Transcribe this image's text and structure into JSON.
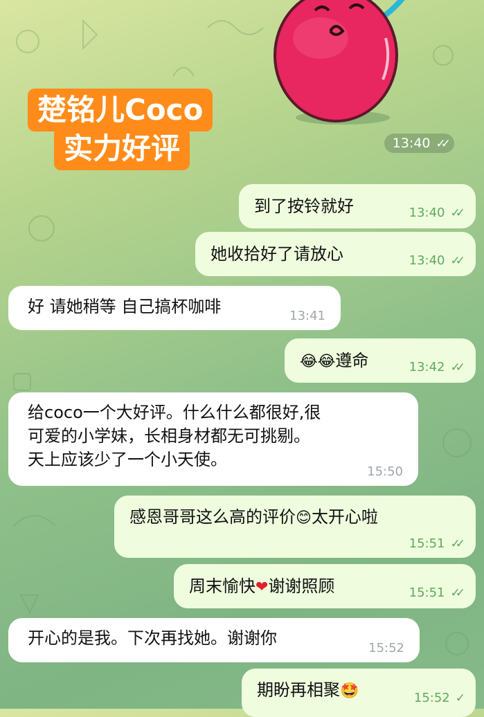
{
  "overlay": {
    "line1": "楚铭儿Coco",
    "line2": "实力好评"
  },
  "sticker": {
    "time": "13:40",
    "check": "✓✓"
  },
  "messages": [
    {
      "dir": "out",
      "text": "到了按铃就好",
      "time": "13:40",
      "check": "✓✓"
    },
    {
      "dir": "out",
      "text": "她收拾好了请放心",
      "time": "13:40",
      "check": "✓✓"
    },
    {
      "dir": "in",
      "text": "好 请她稍等 自己搞杯咖啡",
      "time": "13:41"
    },
    {
      "dir": "out",
      "emoji": "😂😂",
      "text": "遵命",
      "time": "13:42",
      "check": "✓✓"
    },
    {
      "dir": "in",
      "lines": [
        "给coco一个大好评。什么什么都很好,很",
        "可爱的小学妹，长相身材都无可挑剔。",
        "天上应该少了一个小天使。"
      ],
      "time": "15:50"
    },
    {
      "dir": "out",
      "text": "感恩哥哥这么高的评价",
      "emoji": "😊",
      "text2": "太开心啦",
      "time": "15:51",
      "check": "✓✓"
    },
    {
      "dir": "out",
      "text": "周末愉快",
      "emoji": "❤",
      "text2": "谢谢照顾",
      "time": "15:51",
      "check": "✓✓"
    },
    {
      "dir": "in",
      "text": "开心的是我。下次再找她。谢谢你",
      "time": "15:52"
    },
    {
      "dir": "out",
      "text": "期盼再相聚",
      "emoji": "🤩",
      "time": "15:52",
      "check": "✓"
    }
  ],
  "colors": {
    "outgoing_bubble": "#effdde",
    "incoming_bubble": "#ffffff",
    "overlay": "#ff8c1a",
    "sticker": "#e8265f",
    "check": "#5faa5f"
  }
}
